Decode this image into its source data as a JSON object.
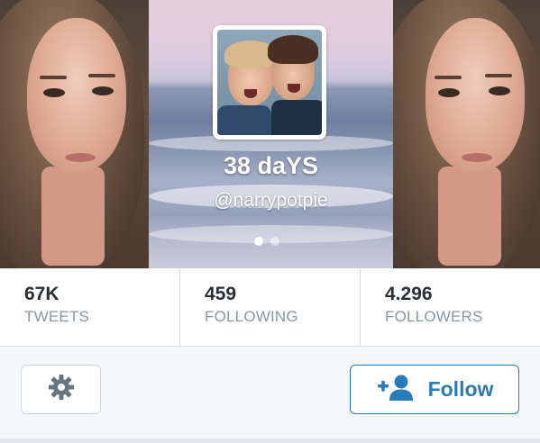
{
  "profile": {
    "display_name": "38 daYS",
    "handle": "@narrypotpie"
  },
  "header": {
    "pager": {
      "pages": 2,
      "active_index": 0
    }
  },
  "stats": [
    {
      "value": "67K",
      "label": "TWEETS"
    },
    {
      "value": "459",
      "label": "FOLLOWING"
    },
    {
      "value": "4.296",
      "label": "FOLLOWERS"
    }
  ],
  "actions": {
    "settings_icon": "gear-icon",
    "follow_icon": "add-user-icon",
    "follow_label": "Follow"
  },
  "colors": {
    "accent": "#2b7bb9",
    "stat_value": "#292f33",
    "stat_label": "#8899a6",
    "icon_gray": "#66757f"
  }
}
